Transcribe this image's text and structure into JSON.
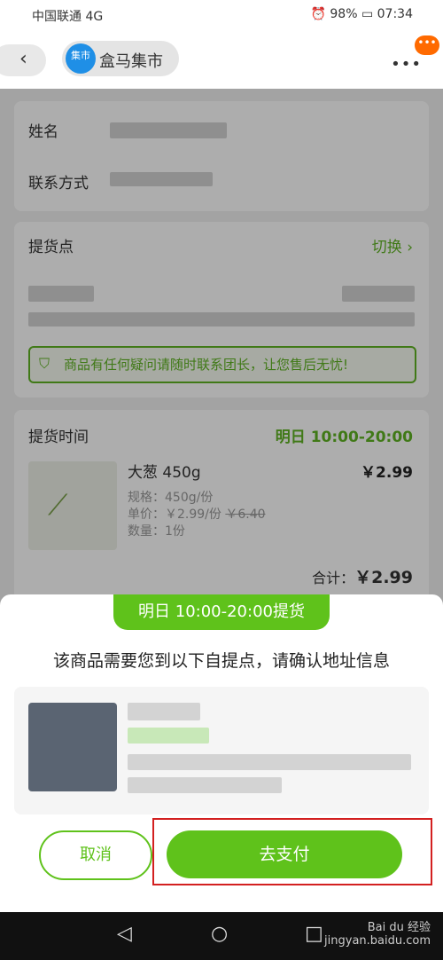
{
  "statusbar": {
    "carrier": "中国联通 4G",
    "battery": "98%",
    "time": "07:34"
  },
  "header": {
    "shop_name": "盒马集市",
    "logo_text": "集市",
    "more": "•••"
  },
  "form": {
    "name_label": "姓名",
    "contact_label": "联系方式"
  },
  "pickup_point": {
    "label": "提货点",
    "switch_label": "切换 ›",
    "notice": "商品有任何疑问请随时联系团长，让您售后无忧!"
  },
  "order": {
    "time_label": "提货时间",
    "time_day": "明日",
    "time_range": "10:00-20:00",
    "product_name": "大葱 450g",
    "product_price": "￥2.99",
    "spec": "规格：450g/份",
    "unit_price_label": "单价：",
    "unit_price": "￥2.99/份",
    "original_price": "￥6.40",
    "quantity": "数量：1份",
    "total_label": "合计：",
    "total": "￥2.99"
  },
  "sheet": {
    "badge": "明日 10:00-20:00提货",
    "title": "该商品需要您到以下自提点，请确认地址信息",
    "cancel": "取消",
    "pay": "去支付"
  },
  "navbar": {
    "back": "◁",
    "home": "○",
    "recent": "□",
    "watermark": "Bai du 经验\njingyan.baidu.com"
  }
}
